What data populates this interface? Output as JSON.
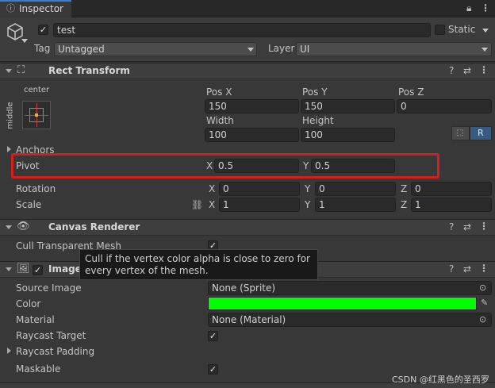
{
  "tab": {
    "label": "Inspector"
  },
  "object": {
    "name": "test",
    "static_label": "Static",
    "tag_label": "Tag",
    "tag_value": "Untagged",
    "layer_label": "Layer",
    "layer_value": "UI"
  },
  "rect_transform": {
    "title": "Rect Transform",
    "anchor_h": "center",
    "anchor_v": "middle",
    "posx_label": "Pos X",
    "posx": "150",
    "posy_label": "Pos Y",
    "posy": "150",
    "posz_label": "Pos Z",
    "posz": "0",
    "width_label": "Width",
    "width": "100",
    "height_label": "Height",
    "height": "100",
    "r_button": "R",
    "anchors_label": "Anchors",
    "pivot_label": "Pivot",
    "pivot_x_label": "X",
    "pivot_x": "0.5",
    "pivot_y_label": "Y",
    "pivot_y": "0.5",
    "rotation_label": "Rotation",
    "rot_x_label": "X",
    "rot_x": "0",
    "rot_y_label": "Y",
    "rot_y": "0",
    "rot_z_label": "Z",
    "rot_z": "0",
    "scale_label": "Scale",
    "scale_x_label": "X",
    "scale_x": "1",
    "scale_y_label": "Y",
    "scale_y": "1",
    "scale_z_label": "Z",
    "scale_z": "1"
  },
  "canvas_renderer": {
    "title": "Canvas Renderer",
    "cull_label": "Cull Transparent Mesh",
    "cull_checked": "✓",
    "tooltip_line1": "Cull if the vertex color alpha is close to zero for",
    "tooltip_line2": "every vertex of the mesh."
  },
  "image": {
    "title": "Image",
    "source_label": "Source Image",
    "source_value": "None (Sprite)",
    "color_label": "Color",
    "color_value": "#00ff00",
    "material_label": "Material",
    "material_value": "None (Material)",
    "raycast_target_label": "Raycast Target",
    "raycast_target_checked": "✓",
    "raycast_padding_label": "Raycast Padding",
    "maskable_label": "Maskable",
    "maskable_checked": "✓"
  },
  "watermark": "CSDN @红黑色的圣西罗",
  "colors": {
    "highlight": "#d91c1c",
    "color_swatch": "#00ff00",
    "accent_blue": "#3b5a83"
  }
}
